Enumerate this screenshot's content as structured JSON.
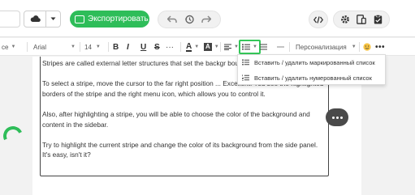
{
  "toolbar": {
    "export_label": "Экспортировать"
  },
  "format_bar": {
    "style_label": "се",
    "font": "Arial",
    "size": "14",
    "bold": "B",
    "italic": "I",
    "underline": "U",
    "strike": "S",
    "font_color": "A",
    "bg_color": "A",
    "personalization_label": "Персонализация"
  },
  "dropdown": {
    "items": [
      {
        "label": "Вставить / удалить маркированный список"
      },
      {
        "label": "Вставить / удалить нумерованный список"
      }
    ]
  },
  "editor": {
    "paragraphs": [
      "Stripes are called external letter structures that set the backgr boundaries of the letter.",
      "To select a stripe, move the cursor to the far right position ... Excellent! You see the highlighted borders of the stripe and the right menu icon, which allows you to control it.",
      "Also, after highlighting a stripe, you will be able to choose the color of the background and content in the sidebar.",
      "Try to highlight the current stripe and change the color of its background from the side panel. It's easy, isn't it?"
    ]
  },
  "colors": {
    "accent_green": "#2ebd59",
    "stripe_border": "#444444",
    "more_button": "#4a4a4a"
  }
}
